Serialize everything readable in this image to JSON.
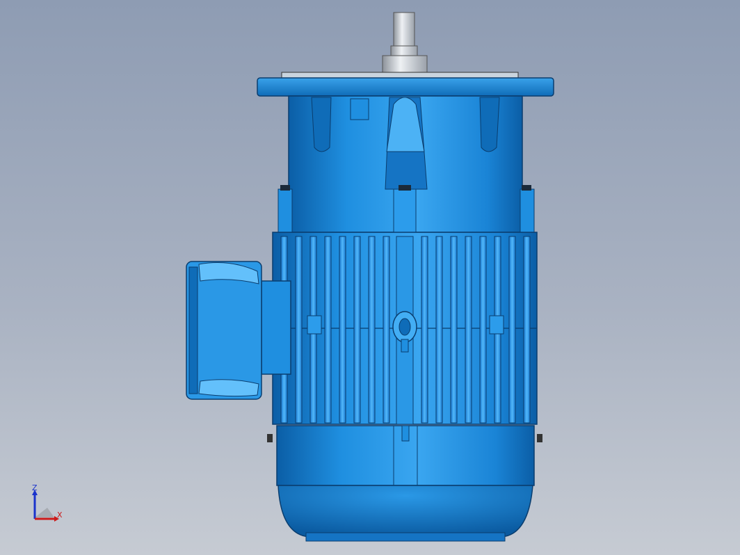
{
  "view": {
    "background_top": "#8e9cb3",
    "background_bottom": "#c6cbd3",
    "model_color": "#1e8ee0",
    "model_dark": "#0a5fa8",
    "model_light": "#5ab4f2"
  },
  "model": {
    "name_icon": "electric-motor-3d-model"
  },
  "triad": {
    "z_label": "Z",
    "x_label": "X",
    "z_color": "#1a33cc",
    "x_color": "#cc1a1a"
  }
}
